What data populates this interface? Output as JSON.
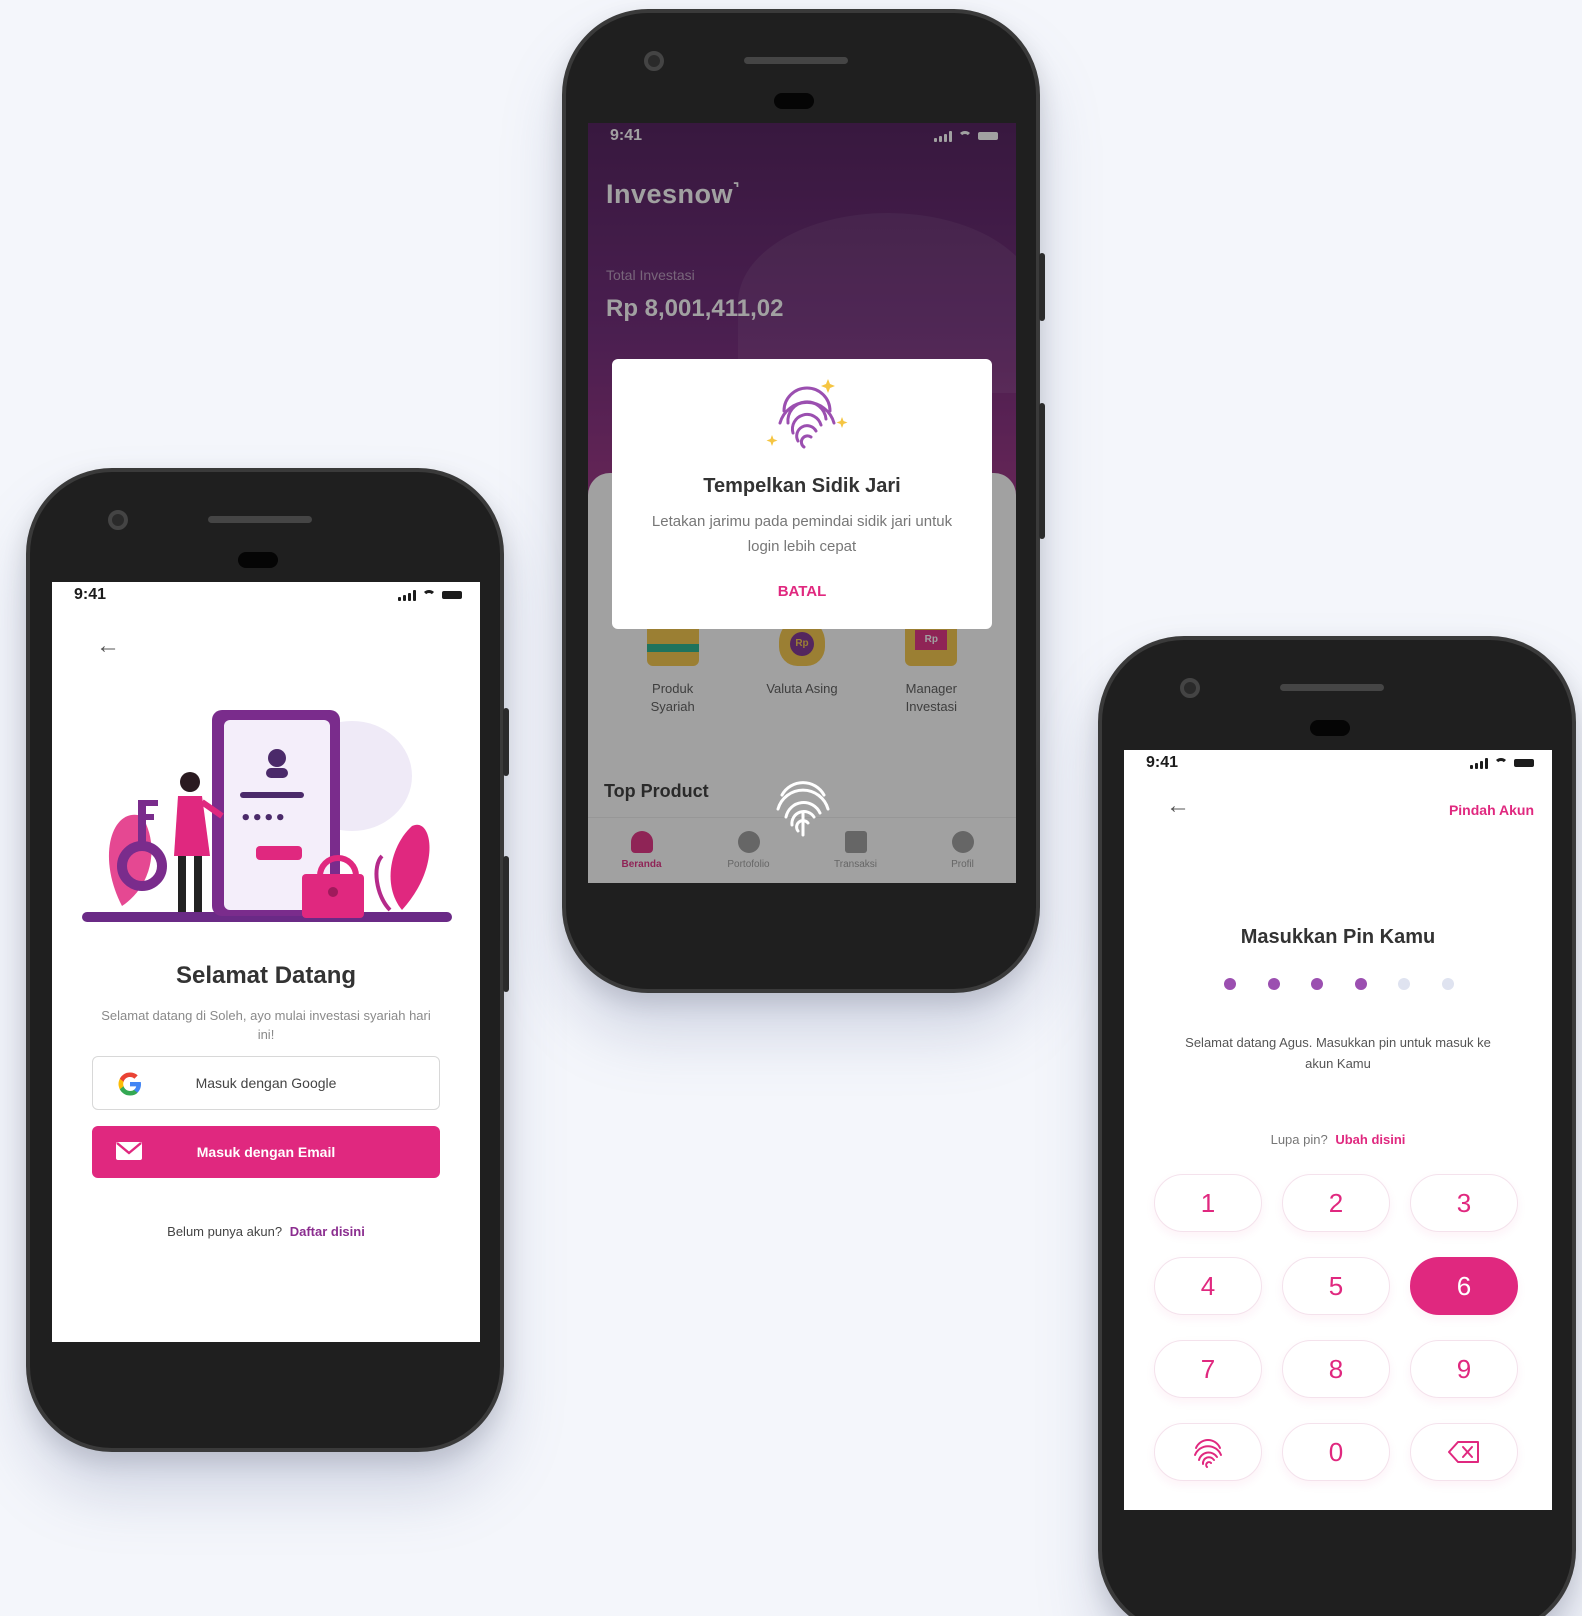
{
  "status_time": "9:41",
  "welcome": {
    "title": "Selamat Datang",
    "subtitle": "Selamat datang di Soleh, ayo mulai investasi syariah hari ini!",
    "google_button": "Masuk dengan Google",
    "email_button": "Masuk dengan Email",
    "register_prompt": "Belum punya akun?",
    "register_link": "Daftar disini",
    "illustration_dots": "••••"
  },
  "dashboard": {
    "brand": "Invesnow",
    "total_label": "Total Investasi",
    "total_value": "Rp 8,001,411,02",
    "menu": [
      {
        "label_line1": "Produk",
        "label_line2": "Syariah"
      },
      {
        "label_line1": "Valuta Asing",
        "label_line2": ""
      },
      {
        "label_line1": "Manager",
        "label_line2": "Investasi"
      }
    ],
    "menu_icon_text": "Rp",
    "top_product": "Top Product",
    "tabs": [
      "Beranda",
      "Portofolio",
      "Transaksi",
      "Profil"
    ],
    "active_tab": "Beranda",
    "dialog": {
      "title": "Tempelkan Sidik Jari",
      "subtitle": "Letakan jarimu pada pemindai sidik jari untuk login lebih cepat",
      "cancel": "BATAL"
    }
  },
  "pin": {
    "switch_account": "Pindah Akun",
    "title": "Masukkan Pin Kamu",
    "filled_count": 4,
    "total_count": 6,
    "subtitle": "Selamat datang Agus. Masukkan pin untuk masuk ke akun Kamu",
    "forgot_prompt": "Lupa pin?",
    "forgot_link": "Ubah disini",
    "keys": [
      "1",
      "2",
      "3",
      "4",
      "5",
      "6",
      "7",
      "8",
      "9",
      "",
      "0",
      ""
    ],
    "active_key": "6"
  },
  "colors": {
    "accent": "#e0287f",
    "purple": "#8b2d8f",
    "dark_purple": "#4a1456",
    "dot_filled": "#9b4fb0",
    "dot_empty": "#dfe3f0"
  }
}
